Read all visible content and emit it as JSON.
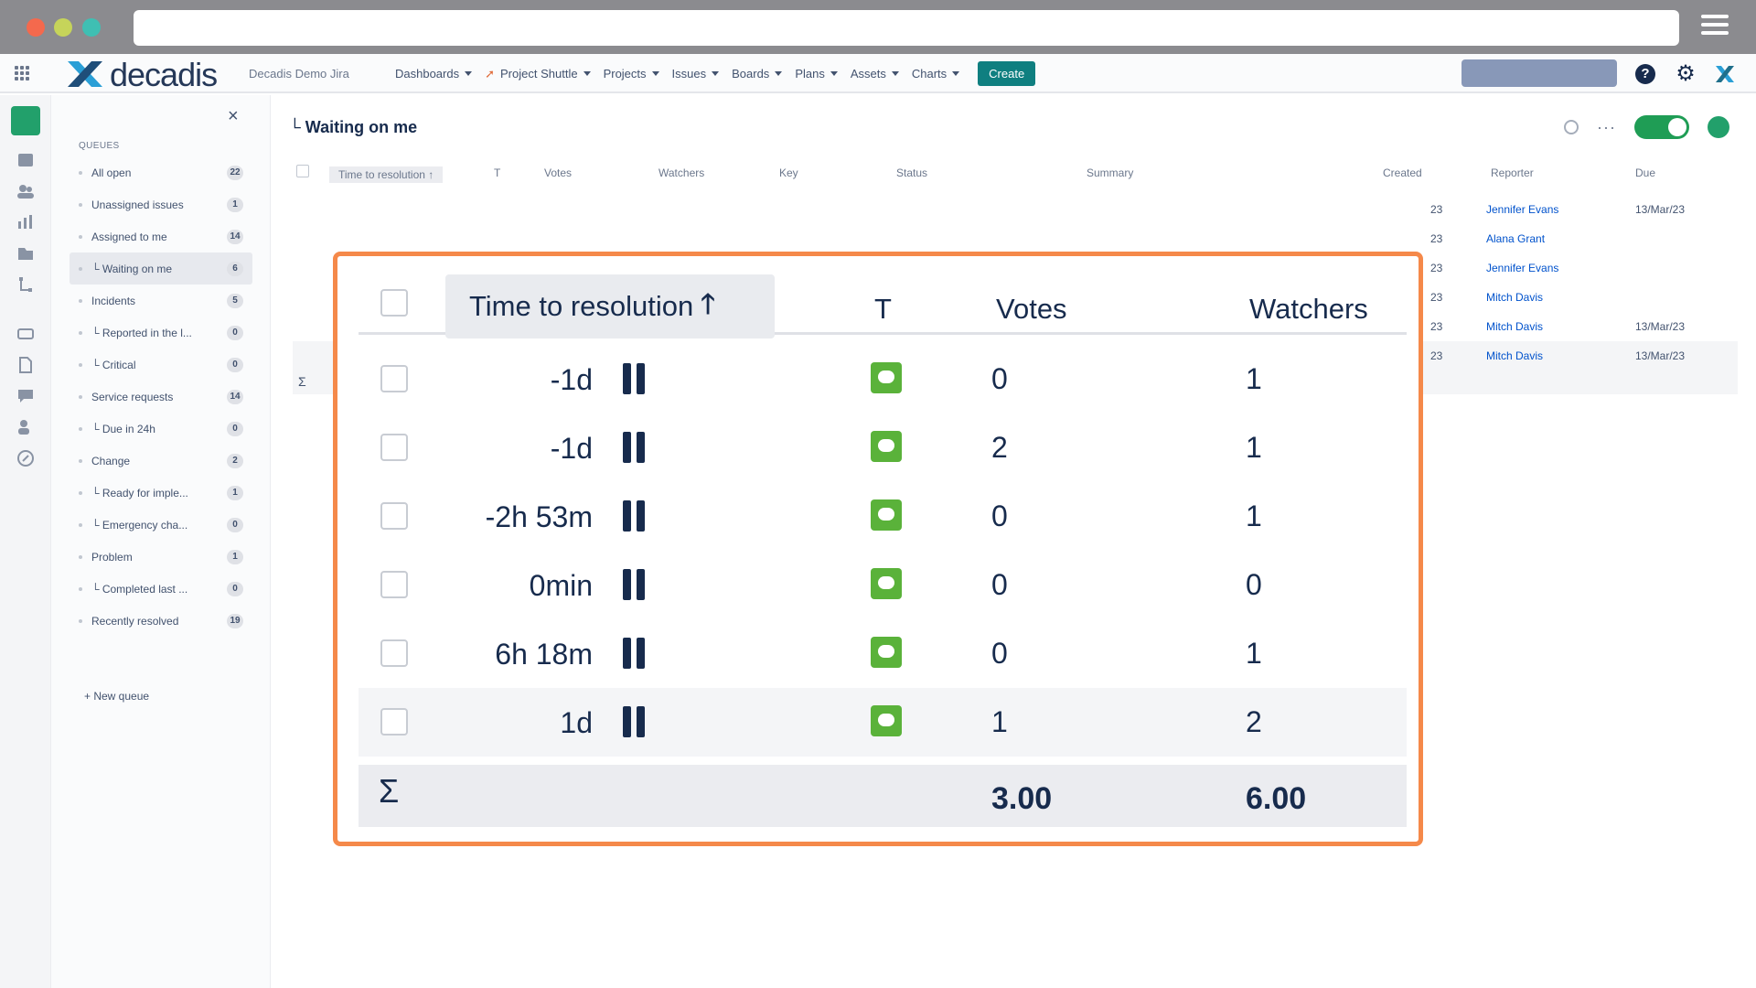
{
  "app": {
    "logo_text": "decadis",
    "site_name": "Decadis Demo Jira",
    "nav": [
      {
        "label": "Dashboards"
      },
      {
        "label": "Project Shuttle"
      },
      {
        "label": "Projects"
      },
      {
        "label": "Issues"
      },
      {
        "label": "Boards"
      },
      {
        "label": "Plans"
      },
      {
        "label": "Assets"
      },
      {
        "label": "Charts"
      }
    ],
    "create_label": "Create",
    "help_glyph": "?",
    "gear_glyph": "⚙"
  },
  "sidebar": {
    "close_glyph": "×",
    "heading": "QUEUES",
    "items": [
      {
        "label": "All open",
        "count": "22"
      },
      {
        "label": "Unassigned issues",
        "count": "1"
      },
      {
        "label": "Assigned to me",
        "count": "14"
      },
      {
        "label": "└ Waiting on me",
        "count": "6"
      },
      {
        "label": "Incidents",
        "count": "5"
      },
      {
        "label": "└ Reported in the l...",
        "count": "0"
      },
      {
        "label": "└ Critical",
        "count": "0"
      },
      {
        "label": "Service requests",
        "count": "14"
      },
      {
        "label": "└ Due in 24h",
        "count": "0"
      },
      {
        "label": "Change",
        "count": "2"
      },
      {
        "label": "└ Ready for imple...",
        "count": "1"
      },
      {
        "label": "└ Emergency cha...",
        "count": "0"
      },
      {
        "label": "Problem",
        "count": "1"
      },
      {
        "label": "└ Completed last ...",
        "count": "0"
      },
      {
        "label": "Recently resolved",
        "count": "19"
      }
    ],
    "new_queue": "+ New queue"
  },
  "main": {
    "title": "└ Waiting on me",
    "more_glyph": "···",
    "bg_columns": [
      "Time to resolution ↑",
      "T",
      "Votes",
      "Watchers",
      "Key",
      "Status",
      "Summary",
      "Created",
      "Reporter",
      "Due"
    ],
    "bg_rows": [
      {
        "created": "23",
        "reporter": "Jennifer Evans",
        "due": "13/Mar/23"
      },
      {
        "created": "23",
        "reporter": "Alana Grant",
        "due": ""
      },
      {
        "created": "23",
        "reporter": "Jennifer Evans",
        "due": ""
      },
      {
        "created": "23",
        "reporter": "Mitch Davis",
        "due": ""
      },
      {
        "created": "23",
        "reporter": "Mitch Davis",
        "due": "13/Mar/23"
      },
      {
        "created": "23",
        "reporter": "Mitch Davis",
        "due": "13/Mar/23"
      }
    ],
    "sigma": "Σ"
  },
  "callout": {
    "headers": {
      "time": "Time to resolution",
      "sort_arrow": "🡑",
      "type": "T",
      "votes": "Votes",
      "watchers": "Watchers"
    },
    "rows": [
      {
        "time": "-1d",
        "votes": "0",
        "watchers": "1"
      },
      {
        "time": "-1d",
        "votes": "2",
        "watchers": "1"
      },
      {
        "time": "-2h 53m",
        "votes": "0",
        "watchers": "1"
      },
      {
        "time": "0min",
        "votes": "0",
        "watchers": "0"
      },
      {
        "time": "6h 18m",
        "votes": "0",
        "watchers": "1"
      },
      {
        "time": "1d",
        "votes": "1",
        "watchers": "2"
      }
    ],
    "sum": {
      "sigma": "Σ",
      "votes": "3.00",
      "watchers": "6.00"
    },
    "accent_color": "#f5894a",
    "type_icon_color": "#5ab23a"
  }
}
